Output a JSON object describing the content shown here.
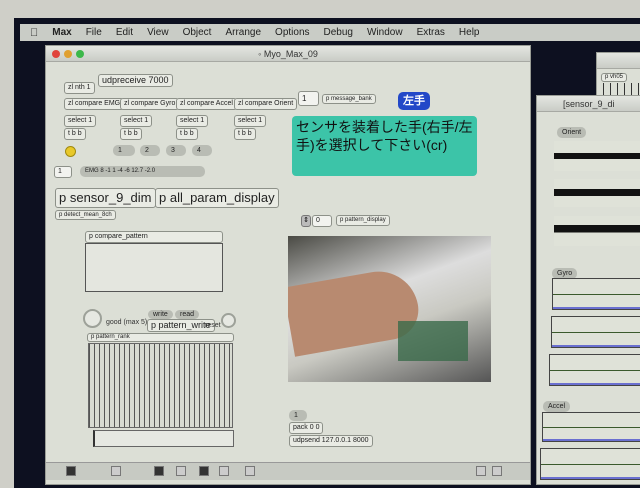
{
  "menubar": {
    "items": [
      "Max",
      "File",
      "Edit",
      "View",
      "Object",
      "Arrange",
      "Options",
      "Debug",
      "Window",
      "Extras",
      "Help"
    ]
  },
  "main_window": {
    "title": "Myo_Max_09"
  },
  "patch": {
    "udpreceive": "udpreceive 7000",
    "zlnth": "zl nth 1",
    "compare": [
      "zl compare EMG",
      "zl compare Gyro",
      "zl compare Accel",
      "zl compare Orient"
    ],
    "select": "select 1",
    "trigger": "t b b",
    "messages": [
      "1",
      "2",
      "3",
      "4"
    ],
    "number_box": "1",
    "emg_message": "EMG 8 -1 1 -4 -6 12.7 -2.0",
    "sensor_dim": "p sensor_9_dim",
    "all_param": "p all_param_display",
    "detect_mean": "p detect_mean_8ch",
    "compare_pattern": "p compare_pattern",
    "good_label": "good (max 5)",
    "write": "write",
    "read": "read",
    "pattern_write": "p pattern_write",
    "reset": "reset",
    "pattern_rank": "p pattern_rank",
    "bank_number": "1",
    "message_bank": "p message_bank",
    "hand_button": "左手",
    "comment": "センサを装着した手(右手/左手)を選択して下さい(cr)",
    "display_number": "0",
    "pattern_display": "p pattern_display",
    "msg_one": "1",
    "pack": "pack 0 0",
    "udpsend": "udpsend 127.0.0.1 8000"
  },
  "sensor_window": {
    "title": "[sensor_9_di",
    "orient": "Orient",
    "gyro": "Gyro",
    "accel": "Accel"
  },
  "small_window": {
    "label": "p vh05"
  },
  "colors": {
    "hand_button": "#2348c8",
    "comment_bg": "#3cc4a8",
    "toggle": "#e8c82a"
  }
}
